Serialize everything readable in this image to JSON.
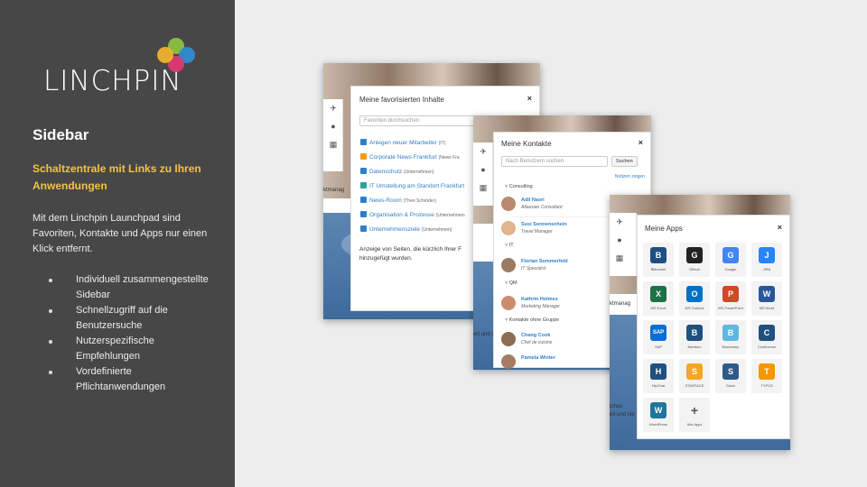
{
  "brand": {
    "name": "LINCHPIN"
  },
  "sidebar": {
    "title": "Sidebar",
    "subtitle": "Schaltzentrale mit Links zu Ihren Anwendungen",
    "description": "Mit dem Linchpin Launchpad sind Favoriten, Kontakte und Apps nur einen Klick entfernt.",
    "bullets": [
      "Individuell zusammengestellte  Sidebar",
      "Schnellzugriff auf die Benutzersuche",
      "Nutzerspezifische Empfehlungen",
      "Vordefinierte Pflichtanwendungen"
    ]
  },
  "favorites": {
    "title": "Meine favorisierten Inhalte",
    "close": "×",
    "search_placeholder": "Favoriten durchsuchen",
    "items": [
      {
        "label": "Anlegen neuer Mitarbeiter",
        "meta": "(IT)",
        "color": "#2f7fc7"
      },
      {
        "label": "Corporate News Frankfurt",
        "meta": "(News Fra",
        "color": "#f39c12"
      },
      {
        "label": "Datenschutz",
        "meta": "(Unternehmen)",
        "color": "#2f7fc7"
      },
      {
        "label": "IT Umstellung am Standort Frankfurt",
        "meta": "",
        "color": "#2aa59b"
      },
      {
        "label": "News-Room",
        "meta": "(Theo Schröder)",
        "color": "#2f7fc7"
      },
      {
        "label": "Organisation & Prozesse",
        "meta": "(Unternehmen",
        "color": "#2f7fc7"
      },
      {
        "label": "Unternehmensziele",
        "meta": "(Unternehmen)",
        "color": "#2f7fc7"
      }
    ],
    "footer": "Anzeige von Seiten, die kürzlich Ihrer F hinzugefügt wurden.",
    "bg_text": "ktmanag"
  },
  "contacts": {
    "title": "Meine Kontakte",
    "close": "×",
    "search_placeholder": "Nach Benutzern suchen",
    "search_button": "Suchen",
    "hint": "Notizen zeigen",
    "groups": [
      {
        "name": "Consulting",
        "people": [
          {
            "name": "Adil Nasri",
            "role": "Atlassian Consultant"
          },
          {
            "name": "Susi Sonnenschein",
            "role": "Travel Manager"
          }
        ]
      },
      {
        "name": "IT",
        "people": [
          {
            "name": "Florian Sommerfeld",
            "role": "IT Specialist"
          }
        ]
      },
      {
        "name": "QM",
        "people": [
          {
            "name": "Kathrin Holmes",
            "role": "Marketing Manager"
          }
        ]
      },
      {
        "name": "Kontakte ohne Gruppe",
        "people": [
          {
            "name": "Chang Cook",
            "role": "Chef de cuisine"
          },
          {
            "name": "Pamela Winter",
            "role": ""
          }
        ]
      }
    ],
    "bg_text_1": "ktmanag",
    "bg_text_2": "ert und nie"
  },
  "apps": {
    "title": "Meine Apps",
    "close": "×",
    "items": [
      {
        "label": "Bitbucket",
        "glyph": "B",
        "color": "#205081"
      },
      {
        "label": "Github",
        "glyph": "G",
        "color": "#222222"
      },
      {
        "label": "Google",
        "glyph": "G",
        "color": "#4285f4"
      },
      {
        "label": "JIRA",
        "glyph": "J",
        "color": "#2684ff"
      },
      {
        "label": "MS Excel",
        "glyph": "X",
        "color": "#1e7145"
      },
      {
        "label": "MS Outlook",
        "glyph": "O",
        "color": "#0072c6"
      },
      {
        "label": "MS PowerPoint",
        "glyph": "P",
        "color": "#d24726"
      },
      {
        "label": "MS Word",
        "glyph": "W",
        "color": "#2b579a"
      },
      {
        "label": "SAP",
        "glyph": "SAP",
        "color": "#0a6ed1"
      },
      {
        "label": "Bamboo",
        "glyph": "B",
        "color": "#205081"
      },
      {
        "label": "Basecamp",
        "glyph": "B",
        "color": "#5eb8e0"
      },
      {
        "label": "Confluence",
        "glyph": "C",
        "color": "#205081"
      },
      {
        "label": "HipChat",
        "glyph": "H",
        "color": "#205081"
      },
      {
        "label": "STARFACE",
        "glyph": "S",
        "color": "#f5a623"
      },
      {
        "label": "Slack",
        "glyph": "S",
        "color": "#2e5a8a"
      },
      {
        "label": "TYPO3",
        "glyph": "T",
        "color": "#f49700"
      },
      {
        "label": "WordPress",
        "glyph": "W",
        "color": "#21759b"
      },
      {
        "label": "Alle Apps",
        "glyph": "+",
        "color": "#f3f3f3"
      }
    ],
    "bg_text_1": "ktmanag",
    "bg_text_2": "tchas",
    "bg_text_3": "eit und nie"
  }
}
